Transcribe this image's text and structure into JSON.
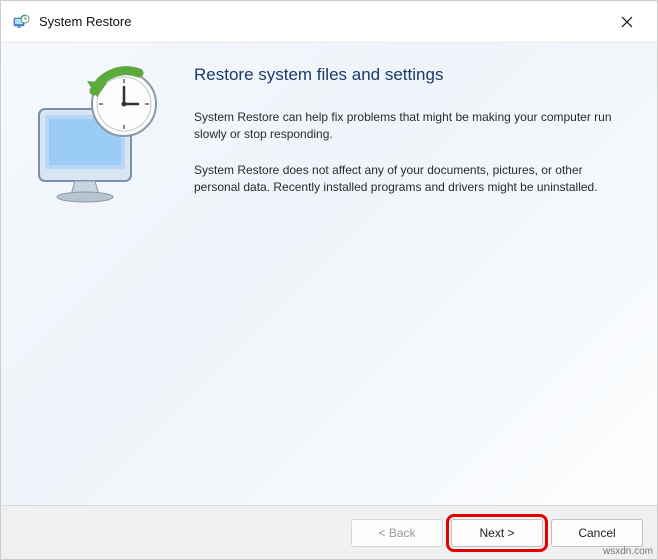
{
  "window": {
    "title": "System Restore"
  },
  "main": {
    "heading": "Restore system files and settings",
    "paragraph1": "System Restore can help fix problems that might be making your computer run slowly or stop responding.",
    "paragraph2": "System Restore does not affect any of your documents, pictures, or other personal data. Recently installed programs and drivers might be uninstalled."
  },
  "buttons": {
    "back": "< Back",
    "next": "Next >",
    "cancel": "Cancel"
  },
  "watermark": "wsxdn.com"
}
